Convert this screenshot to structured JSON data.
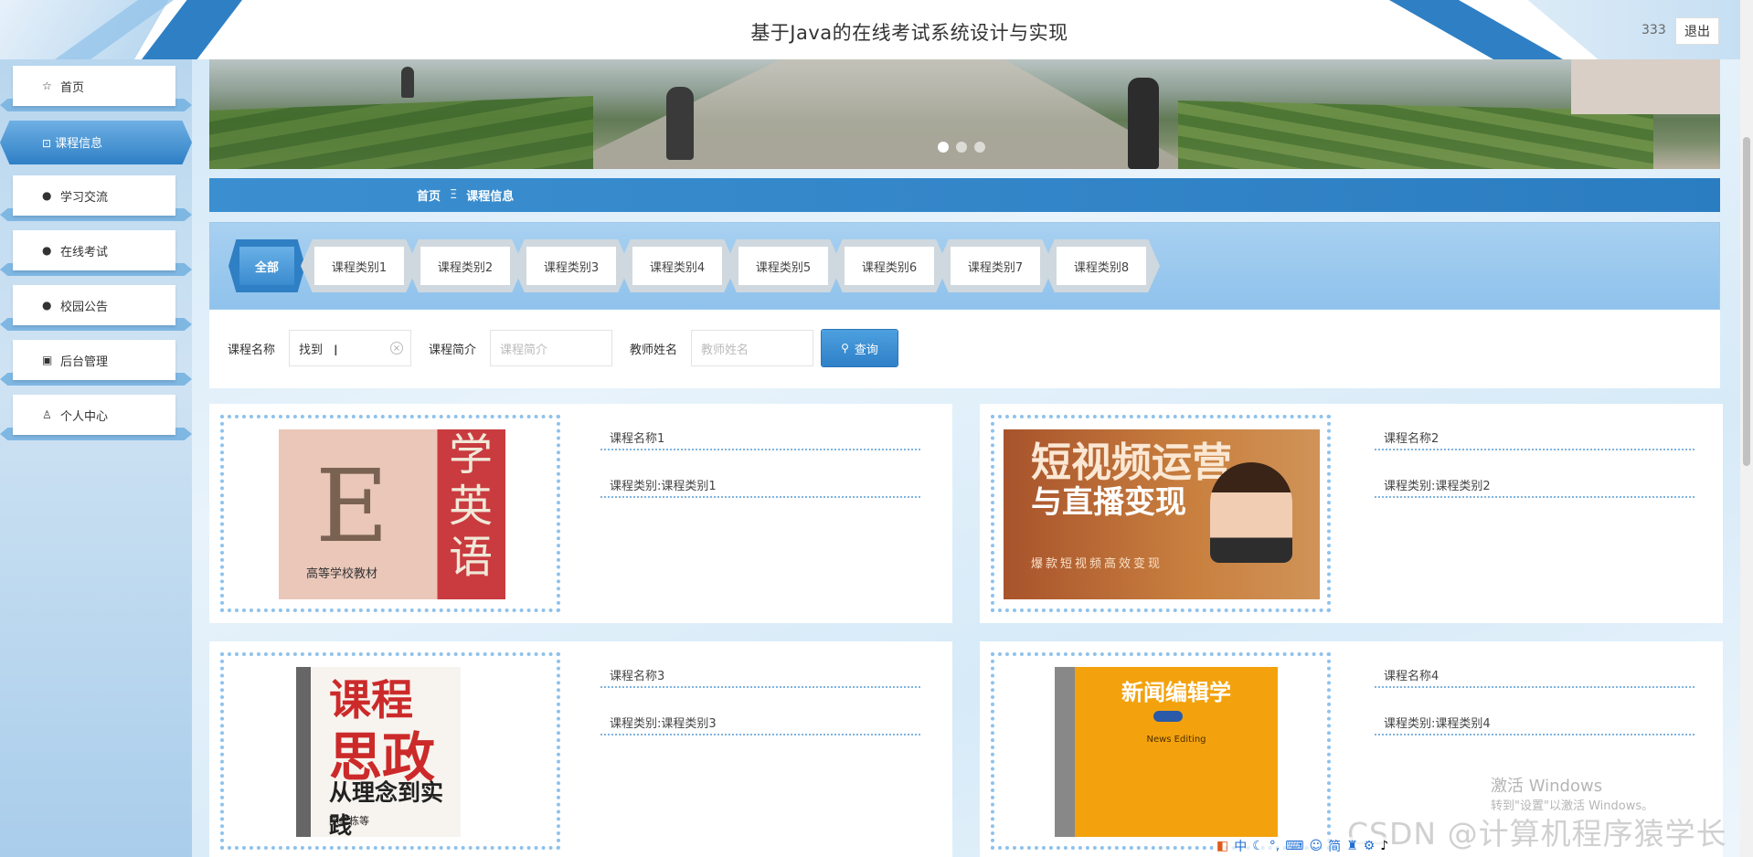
{
  "header": {
    "title": "基于Java的在线考试系统设计与实现",
    "username": "333",
    "logout_label": "退出"
  },
  "sidebar": {
    "items": [
      {
        "label": "首页",
        "icon": "star-icon"
      },
      {
        "label": "课程信息",
        "icon": "bag-icon",
        "active": true
      },
      {
        "label": "学习交流",
        "icon": "exclamation-icon"
      },
      {
        "label": "在线考试",
        "icon": "question-icon"
      },
      {
        "label": "校园公告",
        "icon": "info-icon"
      },
      {
        "label": "后台管理",
        "icon": "briefcase-icon"
      },
      {
        "label": "个人中心",
        "icon": "user-icon"
      }
    ]
  },
  "banner": {
    "slides": 3,
    "active_slide": 1
  },
  "breadcrumb": {
    "home": "首页",
    "separator": "Ξ",
    "current": "课程信息"
  },
  "categories": {
    "tabs": [
      "全部",
      "课程类别1",
      "课程类别2",
      "课程类别3",
      "课程类别4",
      "课程类别5",
      "课程类别6",
      "课程类别7",
      "课程类别8"
    ],
    "active": 0
  },
  "search": {
    "name_label": "课程名称",
    "name_value": "找到",
    "intro_label": "课程简介",
    "intro_placeholder": "课程简介",
    "teacher_label": "教师姓名",
    "teacher_placeholder": "教师姓名",
    "button_label": "查询"
  },
  "courses": [
    {
      "name": "课程名称1",
      "category": "课程类别:课程类别1",
      "cover": {
        "big": "E",
        "vert": "学英语",
        "sub": "高等学校教材"
      }
    },
    {
      "name": "课程名称2",
      "category": "课程类别:课程类别2",
      "cover": {
        "t1": "短视频运营",
        "t2": "与直播变现",
        "t3": "爆款短视频高效变现"
      }
    },
    {
      "name": "课程名称3",
      "category": "课程类别:课程类别3",
      "cover": {
        "t1": "课程",
        "t2": "思政",
        "t3": "从理念到实践",
        "t4": "陈华栋等"
      }
    },
    {
      "name": "课程名称4",
      "category": "课程类别:课程类别4",
      "cover": {
        "t1": "新闻编辑学",
        "t2": "News Editing"
      }
    }
  ],
  "overlays": {
    "activate_windows": "激活 Windows",
    "activate_sub": "转到\"设置\"以激活 Windows。",
    "csdn_watermark": "CSDN @计算机程序猿学长",
    "tray": [
      "中",
      "简"
    ]
  },
  "colors": {
    "accent": "#2f7fc4",
    "tab_bg": "#a8d0f0"
  }
}
